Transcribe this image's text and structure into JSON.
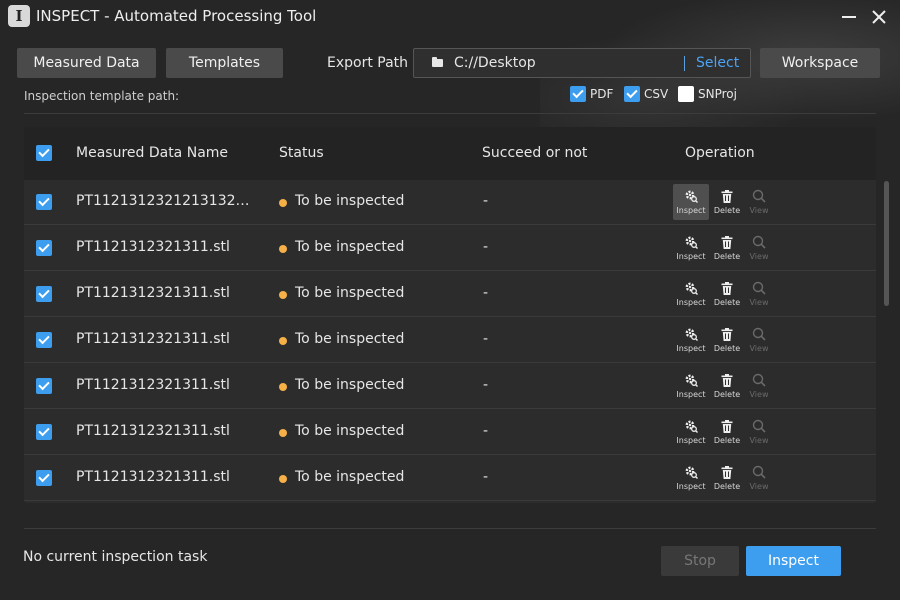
{
  "window": {
    "title": "INSPECT - Automated Processing Tool",
    "logo_text": "I"
  },
  "toolbar": {
    "measured_data_label": "Measured Data",
    "templates_label": "Templates",
    "export_path_label": "Export Path",
    "export_path_value": "C://Desktop",
    "select_label": "Select",
    "workspace_label": "Workspace"
  },
  "template_path_label": "Inspection template path:",
  "formats": [
    {
      "label": "PDF",
      "checked": true
    },
    {
      "label": "CSV",
      "checked": true
    },
    {
      "label": "SNProj",
      "checked": false
    }
  ],
  "table": {
    "columns": {
      "name": "Measured Data Name",
      "status": "Status",
      "succeed": "Succeed or not",
      "operation": "Operation"
    },
    "op_labels": {
      "inspect": "Inspect",
      "delete": "Delete",
      "view": "View"
    },
    "rows": [
      {
        "name": "PT112131232121313213...",
        "status": "To be inspected",
        "succeed": "-"
      },
      {
        "name": "PT1121312321311.stl",
        "status": "To be inspected",
        "succeed": "-"
      },
      {
        "name": "PT1121312321311.stl",
        "status": "To be inspected",
        "succeed": "-"
      },
      {
        "name": "PT1121312321311.stl",
        "status": "To be inspected",
        "succeed": "-"
      },
      {
        "name": "PT1121312321311.stl",
        "status": "To be inspected",
        "succeed": "-"
      },
      {
        "name": "PT1121312321311.stl",
        "status": "To be inspected",
        "succeed": "-"
      },
      {
        "name": "PT1121312321311.stl",
        "status": "To be inspected",
        "succeed": "-"
      }
    ]
  },
  "footer": {
    "status_text": "No current inspection task",
    "stop_label": "Stop",
    "inspect_label": "Inspect"
  },
  "colors": {
    "accent": "#3d9ef0",
    "status_pending": "#f5b048"
  }
}
